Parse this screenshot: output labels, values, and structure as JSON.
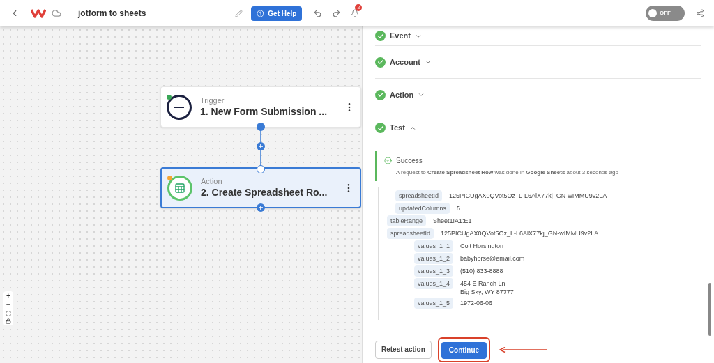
{
  "header": {
    "title": "jotform to sheets",
    "help_button": "Get Help",
    "notification_count": "2",
    "toggle": {
      "label": "OFF",
      "on": false
    }
  },
  "canvas": {
    "nodes": [
      {
        "type": "Trigger",
        "title": "1. New Form Submission ...",
        "selected": false,
        "kind": "jotform",
        "color": "#3aa757"
      },
      {
        "type": "Action",
        "title": "2. Create Spreadsheet Ro...",
        "selected": true,
        "kind": "sheets",
        "color": "#f4a534"
      }
    ],
    "zoom_controls": [
      "+",
      "−"
    ]
  },
  "panel": {
    "sections": [
      {
        "label": "Event",
        "expanded": false
      },
      {
        "label": "Account",
        "expanded": false
      },
      {
        "label": "Action",
        "expanded": false
      },
      {
        "label": "Test",
        "expanded": true
      }
    ],
    "success": {
      "title": "Success",
      "message": "A request to **Create Spreadsheet Row** was done in **Google Sheets** about 3 seconds ago"
    },
    "data": [
      {
        "children": [
          {
            "key": "spreadsheetId",
            "value": [
              "125PICUgAX0QVot5Oz_L-L6AlX77kj_GN-wIMMU9v2LA"
            ]
          },
          {
            "key": "updatedColumns",
            "value": [
              "5"
            ]
          }
        ]
      },
      {
        "key": "tableRange",
        "value": [
          "Sheet1!A1:E1"
        ]
      },
      {
        "key": "spreadsheetId",
        "value": [
          "125PICUgAX0QVot5Oz_L-L6AlX77kj_GN-wIMMU9v2LA"
        ]
      },
      {
        "children": [
          {
            "children": [
              {
                "key": "values_1_1",
                "value": [
                  "Colt Horsington"
                ]
              },
              {
                "key": "values_1_2",
                "value": [
                  "babyhorse@email.com"
                ]
              },
              {
                "key": "values_1_3",
                "value": [
                  "(510) 833-8888"
                ]
              },
              {
                "key": "values_1_4",
                "value": [
                  "454 E Ranch Ln",
                  "Big Sky, WY 87777"
                ]
              },
              {
                "key": "values_1_5",
                "value": [
                  "1972-06-06"
                ]
              }
            ]
          }
        ]
      }
    ],
    "buttons": {
      "retest": "Retest action",
      "continue": "Continue"
    }
  }
}
